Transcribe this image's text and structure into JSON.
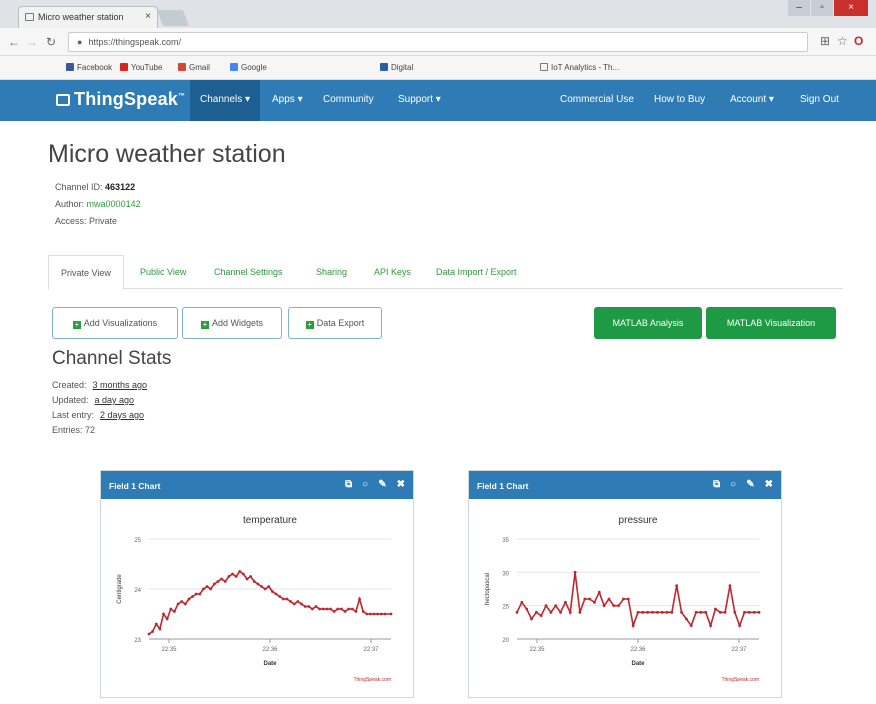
{
  "browser": {
    "tab_title": "Micro weather station",
    "url": "https://thingspeak.com/",
    "bookmarks": [
      "Facebook",
      "YouTube",
      "Gmail",
      "Google",
      "Digital",
      "IoT Analytics - Th..."
    ]
  },
  "nav": {
    "brand": "ThingSpeak",
    "items": [
      "Channels",
      "Apps",
      "Community",
      "Support"
    ],
    "right_items": [
      "Commercial Use",
      "How to Buy",
      "Account",
      "Sign Out"
    ]
  },
  "channel": {
    "title": "Micro weather station",
    "id_label": "Channel ID:",
    "id_value": "463122",
    "author_label": "Author:",
    "author_value": "mwa0000142",
    "access_label": "Access:",
    "access_value": "Private"
  },
  "tabs": [
    "Private View",
    "Public View",
    "Channel Settings",
    "Sharing",
    "API Keys",
    "Data Import / Export"
  ],
  "buttons": {
    "add_visualizations": "Add Visualizations",
    "add_widgets": "Add Widgets",
    "data_export": "Data Export",
    "matlab_analysis": "MATLAB Analysis",
    "matlab_visualization": "MATLAB Visualization"
  },
  "stats": {
    "title": "Channel Stats",
    "created_label": "Created:",
    "created_value": "3 months ago",
    "updated_label": "Updated:",
    "updated_value": "a day ago",
    "last_entry_label": "Last entry:",
    "last_entry_value": "2 days ago",
    "entries_label": "Entries:",
    "entries_value": "72"
  },
  "colors": {
    "navbar": "#2e7bb5",
    "green": "#1f9a44",
    "line": "#c0262d"
  },
  "chart_data": [
    {
      "type": "line",
      "widget_title": "Field 1 Chart",
      "title": "temperature",
      "xlabel": "Date",
      "ylabel": "Centigrade",
      "credit": "ThingSpeak.com",
      "y_ticks": [
        "25",
        "24",
        "23"
      ],
      "ylim": [
        23,
        25
      ],
      "x_ticks": [
        "22:35",
        "22:36",
        "22:37"
      ],
      "x": [
        0.0,
        0.015,
        0.03,
        0.045,
        0.06,
        0.075,
        0.09,
        0.105,
        0.12,
        0.135,
        0.15,
        0.165,
        0.18,
        0.195,
        0.21,
        0.225,
        0.24,
        0.255,
        0.27,
        0.285,
        0.3,
        0.315,
        0.33,
        0.345,
        0.36,
        0.375,
        0.39,
        0.405,
        0.42,
        0.435,
        0.45,
        0.465,
        0.48,
        0.495,
        0.51,
        0.525,
        0.54,
        0.555,
        0.57,
        0.585,
        0.6,
        0.615,
        0.63,
        0.645,
        0.66,
        0.675,
        0.69,
        0.705,
        0.72,
        0.735,
        0.75,
        0.765,
        0.78,
        0.795,
        0.81,
        0.825,
        0.84,
        0.855,
        0.87,
        0.885,
        0.9,
        0.915,
        0.93,
        0.945,
        0.96,
        0.975,
        1.0
      ],
      "values": [
        23.1,
        23.15,
        23.3,
        23.2,
        23.5,
        23.4,
        23.6,
        23.55,
        23.7,
        23.75,
        23.7,
        23.8,
        23.85,
        23.9,
        23.9,
        24.0,
        24.05,
        24.0,
        24.1,
        24.15,
        24.2,
        24.15,
        24.25,
        24.3,
        24.25,
        24.35,
        24.3,
        24.2,
        24.25,
        24.15,
        24.1,
        24.05,
        24.0,
        24.05,
        23.95,
        23.9,
        23.85,
        23.8,
        23.8,
        23.75,
        23.7,
        23.75,
        23.7,
        23.65,
        23.65,
        23.6,
        23.65,
        23.6,
        23.6,
        23.6,
        23.6,
        23.55,
        23.6,
        23.6,
        23.55,
        23.6,
        23.6,
        23.55,
        23.8,
        23.55,
        23.5,
        23.5,
        23.5,
        23.5,
        23.5,
        23.5,
        23.5
      ]
    },
    {
      "type": "line",
      "widget_title": "Field 1 Chart",
      "title": "pressure",
      "xlabel": "Date",
      "ylabel": "hectopascal",
      "credit": "ThingSpeak.com",
      "y_ticks": [
        "35",
        "30",
        "25",
        "20"
      ],
      "ylim": [
        20,
        35
      ],
      "x_ticks": [
        "22:35",
        "22:36",
        "22:37"
      ],
      "x": [
        0.0,
        0.02,
        0.04,
        0.06,
        0.08,
        0.1,
        0.12,
        0.14,
        0.16,
        0.18,
        0.2,
        0.22,
        0.24,
        0.26,
        0.28,
        0.3,
        0.32,
        0.34,
        0.36,
        0.38,
        0.4,
        0.42,
        0.44,
        0.46,
        0.48,
        0.5,
        0.52,
        0.54,
        0.56,
        0.58,
        0.6,
        0.62,
        0.64,
        0.66,
        0.68,
        0.7,
        0.72,
        0.74,
        0.76,
        0.78,
        0.8,
        0.82,
        0.84,
        0.86,
        0.88,
        0.9,
        0.92,
        0.94,
        0.96,
        0.98,
        1.0
      ],
      "values": [
        24,
        25.5,
        24.5,
        23,
        24,
        23.5,
        25,
        24,
        25,
        24,
        25.5,
        24,
        30,
        24,
        26,
        26,
        25.5,
        27,
        25,
        26,
        25,
        25,
        26,
        26,
        22,
        24,
        24,
        24,
        24,
        24,
        24,
        24,
        24,
        28,
        24,
        23,
        22,
        24,
        24,
        24,
        22,
        24.5,
        24,
        24,
        28,
        24,
        22,
        24,
        24,
        24,
        24
      ]
    }
  ]
}
